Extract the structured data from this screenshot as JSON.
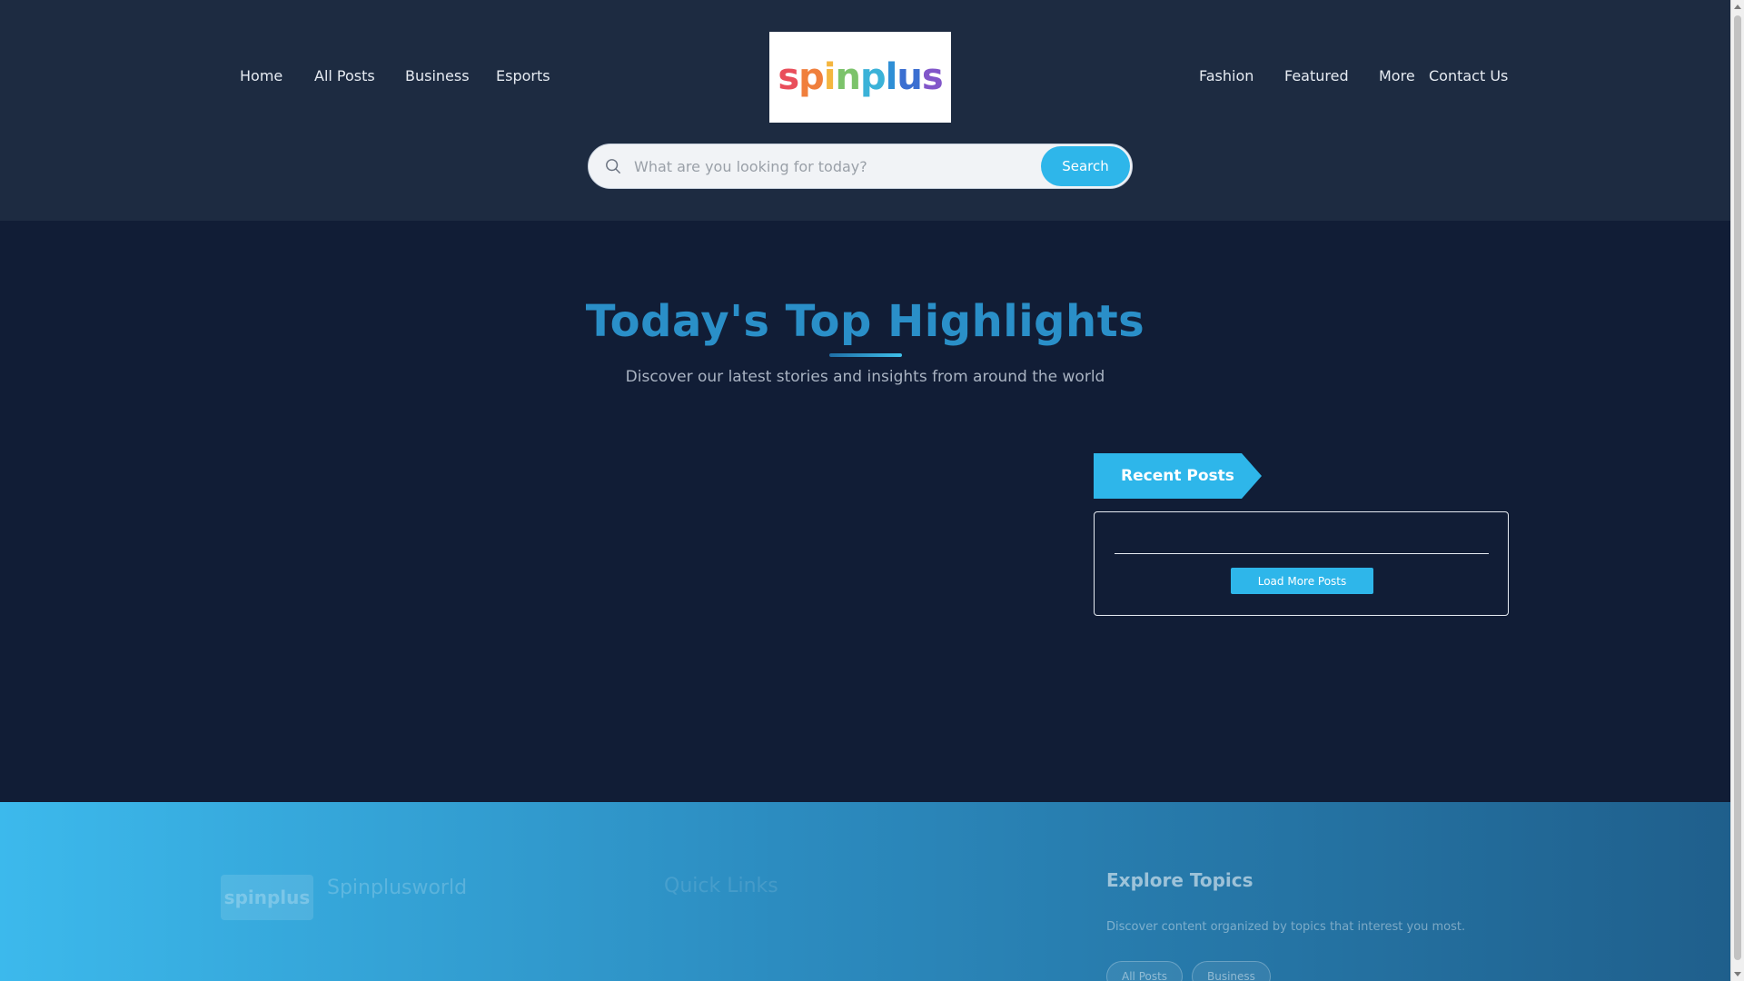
{
  "header": {
    "nav_left": [
      {
        "label": "Home"
      },
      {
        "label": "All Posts"
      },
      {
        "label": "Business"
      },
      {
        "label": "Esports"
      }
    ],
    "nav_right": [
      {
        "label": "Fashion"
      },
      {
        "label": "Featured"
      },
      {
        "label": "More"
      },
      {
        "label": "Contact Us"
      }
    ],
    "logo": {
      "letters": [
        "s",
        "p",
        "i",
        "n",
        "p",
        "l",
        "u",
        "s"
      ]
    },
    "search": {
      "placeholder": "What are you looking for today?",
      "value": "",
      "button_label": "Search",
      "icon": "search-icon"
    }
  },
  "hero": {
    "title": "Today's Top Highlights",
    "subtitle": "Discover our latest stories and insights from around the world"
  },
  "recent_posts": {
    "tab_label": "Recent Posts",
    "tab_icon": "",
    "load_more_label": " Load More Posts"
  },
  "footer": {
    "logo_text": "spinplus",
    "brand_name": "Spinplusworld",
    "column2_title": "Quick Links",
    "column3_title": "Explore Topics",
    "column3_description": "Discover content organized by topics that interest you most.",
    "topics": [
      {
        "label": "All Posts"
      },
      {
        "label": "Business"
      }
    ]
  },
  "colors": {
    "header_bg": "#1d2b41",
    "page_bg": "#111d36",
    "accent": "#2eb6ea",
    "title": "#2a8fc8"
  }
}
